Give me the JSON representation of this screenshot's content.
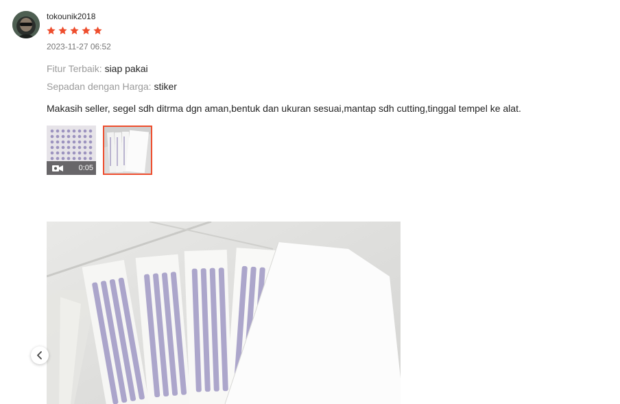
{
  "review": {
    "username": "tokounik2018",
    "rating": 5,
    "timestamp": "2023-11-27 06:52",
    "attributes": [
      {
        "label": "Fitur Terbaik:",
        "value": "siap pakai"
      },
      {
        "label": "Sepadan dengan Harga:",
        "value": "stiker"
      }
    ],
    "comment": "Makasih seller, segel sdh ditrma dgn aman,bentuk dan ukuran sesuai,mantap sdh cutting,tinggal tempel ke alat.",
    "media": [
      {
        "type": "video",
        "duration": "0:05",
        "icon": "video-camera-icon"
      },
      {
        "type": "image",
        "selected": true
      }
    ]
  },
  "colors": {
    "star": "#ee4d2d",
    "selected_border": "#ee4d2d"
  }
}
